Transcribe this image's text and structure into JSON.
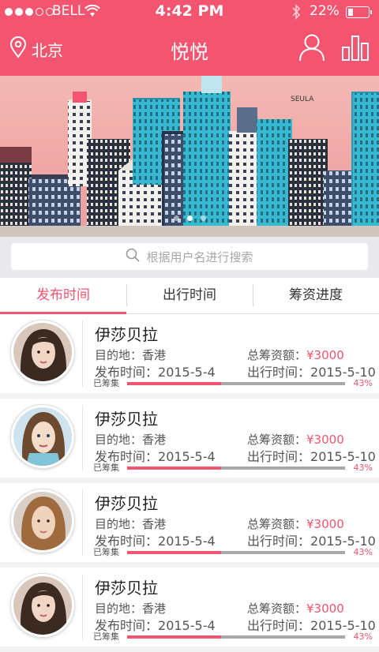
{
  "status_bar": {
    "carrier": "BELL",
    "time": "4:42 PM",
    "battery": "22%"
  },
  "header": {
    "location": "北京",
    "title": "悦悦"
  },
  "banner": {
    "signature": "SEULA",
    "pages": 3,
    "active_page": 1
  },
  "search": {
    "placeholder": "根据用户名进行搜索"
  },
  "tabs": [
    {
      "label": "发布时间",
      "active": true
    },
    {
      "label": "出行时间",
      "active": false
    },
    {
      "label": "筹资进度",
      "active": false
    }
  ],
  "labels": {
    "destination": "目的地：",
    "total": "总筹资额：",
    "publish": "发布时间：",
    "travel": "出行时间：",
    "raised": "已筹集"
  },
  "colors": {
    "accent": "#f3546f"
  },
  "items": [
    {
      "name": "伊莎贝拉",
      "destination": "香港",
      "total": "¥3000",
      "publish_date": "2015-5-4",
      "travel_date": "2015-5-10",
      "progress": "43%",
      "progress_value": 0.43,
      "avatar": "avatar-woman-1"
    },
    {
      "name": "伊莎贝拉",
      "destination": "香港",
      "total": "¥3000",
      "publish_date": "2015-5-4",
      "travel_date": "2015-5-10",
      "progress": "43%",
      "progress_value": 0.43,
      "avatar": "avatar-woman-2"
    },
    {
      "name": "伊莎贝拉",
      "destination": "香港",
      "total": "¥3000",
      "publish_date": "2015-5-4",
      "travel_date": "2015-5-10",
      "progress": "43%",
      "progress_value": 0.43,
      "avatar": "avatar-woman-3"
    },
    {
      "name": "伊莎贝拉",
      "destination": "香港",
      "total": "¥3000",
      "publish_date": "2015-5-4",
      "travel_date": "2015-5-10",
      "progress": "43%",
      "progress_value": 0.43,
      "avatar": "avatar-woman-1"
    }
  ]
}
